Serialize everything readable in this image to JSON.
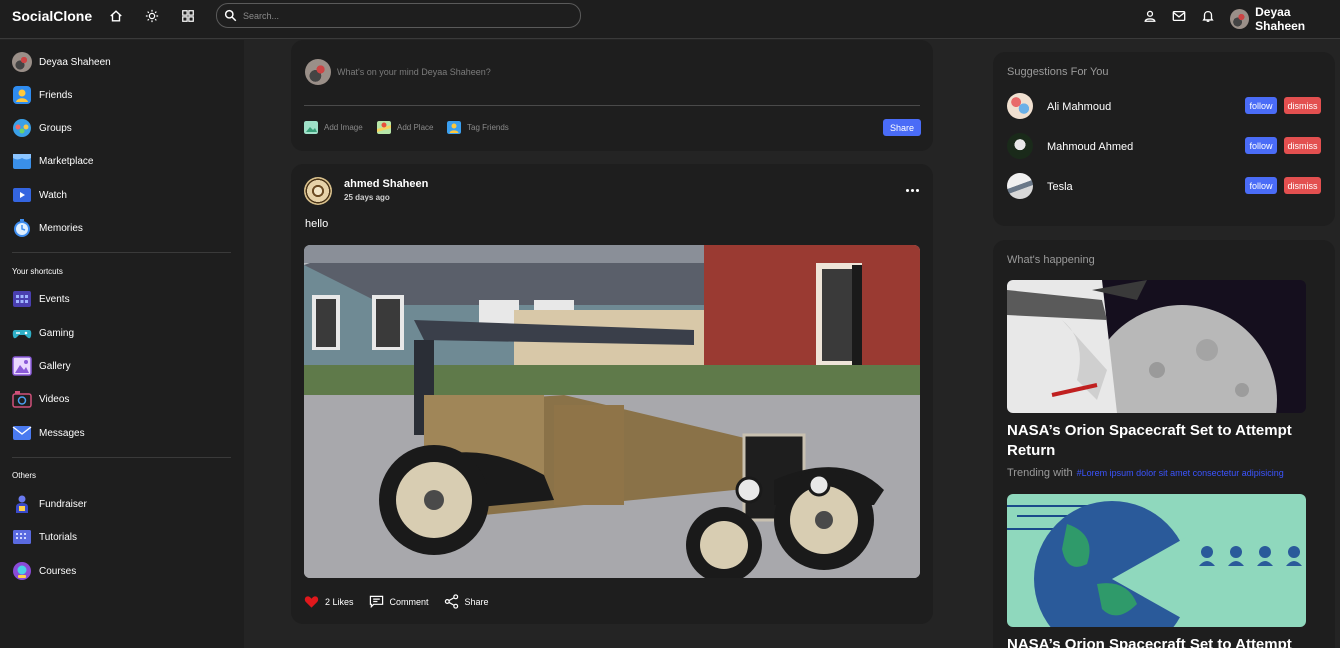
{
  "header": {
    "brand": "SocialClone",
    "search_placeholder": "Search...",
    "user_name": "Deyaa Shaheen",
    "icons": [
      "home-icon",
      "brightness-icon",
      "apps-grid-icon",
      "user-icon",
      "mail-icon",
      "bell-icon"
    ]
  },
  "sidebar": {
    "user_name": "Deyaa Shaheen",
    "main_items": [
      {
        "label": "Friends",
        "icon": "friends-icon"
      },
      {
        "label": "Groups",
        "icon": "groups-icon"
      },
      {
        "label": "Marketplace",
        "icon": "marketplace-icon"
      },
      {
        "label": "Watch",
        "icon": "watch-icon"
      },
      {
        "label": "Memories",
        "icon": "memories-icon"
      }
    ],
    "shortcuts_heading": "Your shortcuts",
    "shortcuts": [
      {
        "label": "Events",
        "icon": "events-icon"
      },
      {
        "label": "Gaming",
        "icon": "gaming-icon"
      },
      {
        "label": "Gallery",
        "icon": "gallery-icon"
      },
      {
        "label": "Videos",
        "icon": "videos-icon"
      },
      {
        "label": "Messages",
        "icon": "messages-icon"
      }
    ],
    "others_heading": "Others",
    "others": [
      {
        "label": "Fundraiser",
        "icon": "fundraiser-icon"
      },
      {
        "label": "Tutorials",
        "icon": "tutorials-icon"
      },
      {
        "label": "Courses",
        "icon": "courses-icon"
      }
    ]
  },
  "composer": {
    "placeholder": "What's on your mind Deyaa Shaheen?",
    "add_image": "Add Image",
    "add_place": "Add Place",
    "tag_friends": "Tag Friends",
    "share_label": "Share"
  },
  "post": {
    "author": "ahmed Shaheen",
    "time": "25 days ago",
    "text": "hello",
    "likes_label": "2 Likes",
    "comment_label": "Comment",
    "share_label": "Share"
  },
  "suggestions": {
    "title": "Suggestions For You",
    "follow_label": "follow",
    "dismiss_label": "dismiss",
    "people": [
      {
        "name": "Ali Mahmoud"
      },
      {
        "name": "Mahmoud Ahmed"
      },
      {
        "name": "Tesla"
      }
    ]
  },
  "happening": {
    "title": "What's happening",
    "articles": [
      {
        "title": "NASA’s Orion Spacecraft Set to Attempt Return",
        "trending_label": "Trending with",
        "tag": "#Lorem ipsum dolor sit amet consectetur adipisicing"
      },
      {
        "title": "NASA’s Orion Spacecraft Set to Attempt"
      }
    ]
  },
  "colors": {
    "accent": "#4a6cf7",
    "danger": "#e35050",
    "like": "#e0181c",
    "bg": "#242424",
    "panel": "#1e1e1e"
  }
}
